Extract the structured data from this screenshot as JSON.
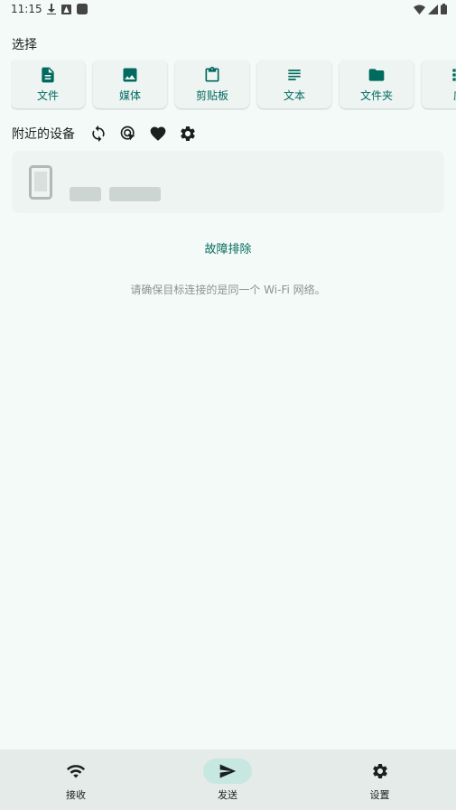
{
  "status": {
    "time": "11:15"
  },
  "selection": {
    "title": "选择",
    "items": [
      {
        "label": "文件",
        "icon": "file-icon"
      },
      {
        "label": "媒体",
        "icon": "image-icon"
      },
      {
        "label": "剪贴板",
        "icon": "clipboard-icon"
      },
      {
        "label": "文本",
        "icon": "text-icon"
      },
      {
        "label": "文件夹",
        "icon": "folder-icon"
      },
      {
        "label": "应",
        "icon": "apps-icon"
      }
    ]
  },
  "nearby": {
    "title": "附近的设备",
    "actions": [
      "refresh-icon",
      "scan-icon",
      "favorite-icon",
      "settings-icon"
    ]
  },
  "troubleshoot": "故障排除",
  "hint": "请确保目标连接的是同一个 Wi-Fi 网络。",
  "bottom_nav": [
    {
      "label": "接收",
      "icon": "wifi-icon",
      "active": false
    },
    {
      "label": "发送",
      "icon": "send-icon",
      "active": true
    },
    {
      "label": "设置",
      "icon": "settings-icon",
      "active": false
    }
  ],
  "colors": {
    "accent": "#006a5e",
    "background": "#f4faf8",
    "nav_active": "#c6e8e1"
  }
}
